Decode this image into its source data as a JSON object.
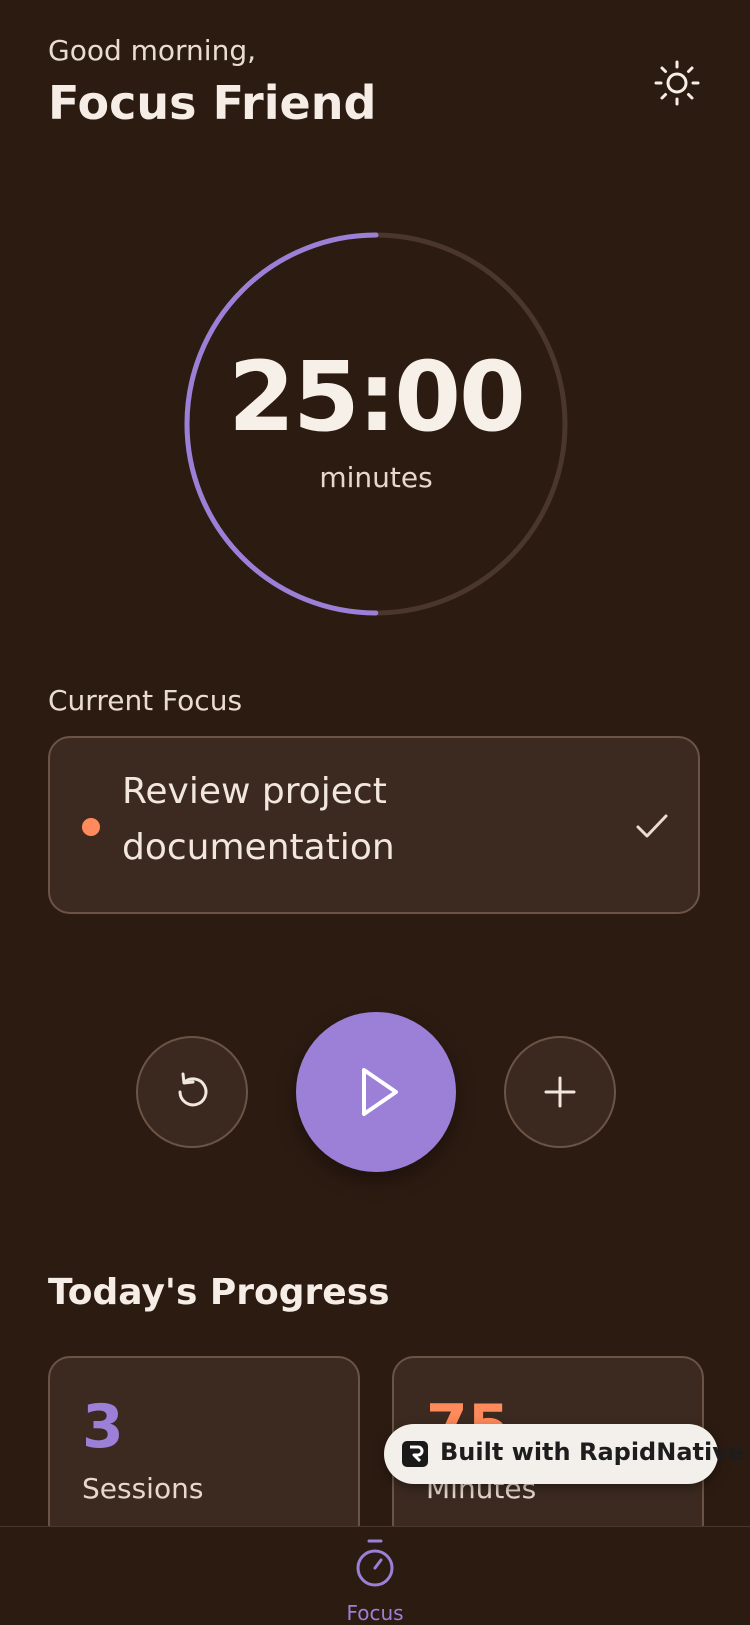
{
  "header": {
    "greeting": "Good morning,",
    "name": "Focus Friend",
    "theme_icon": "sun-icon"
  },
  "timer": {
    "time": "25:00",
    "unit": "minutes",
    "progress": 0.5,
    "colors": {
      "accent": "#9c80d8",
      "track": "#4a362a"
    }
  },
  "current_focus": {
    "label": "Current Focus",
    "task": "Review project documentation",
    "dot_color": "#ff8a5b",
    "check_icon": "check-icon"
  },
  "controls": {
    "reset_icon": "reset-icon",
    "play_icon": "play-icon",
    "add_icon": "plus-icon"
  },
  "progress": {
    "title": "Today's Progress",
    "stats": [
      {
        "value": "3",
        "label": "Sessions",
        "color": "#9c80d8"
      },
      {
        "value": "75",
        "label": "Minutes",
        "color": "#ff8a5b"
      }
    ]
  },
  "badge": {
    "text": "Built with RapidNative"
  },
  "tabbar": {
    "focus_label": "Focus",
    "focus_icon": "stopwatch-icon"
  }
}
